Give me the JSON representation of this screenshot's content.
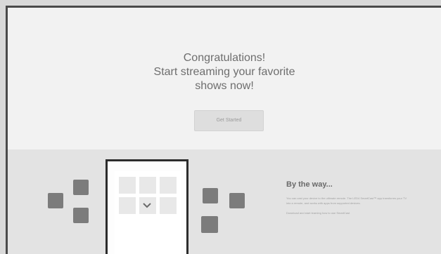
{
  "promo": {
    "headline_line1": "Congratulations!",
    "headline_line2": "Start streaming your favorite",
    "headline_line3": "shows now!",
    "cta_label": "Get Started"
  },
  "info": {
    "title": "By the way...",
    "paragraph1": "You can cast your device to the ultimate remote. The LED4 SmartCast™ app transforms your TV into a remote, and works with apps from supported devices.",
    "paragraph2": "Download and start learning how to use SmartCast"
  },
  "icons": {
    "chevron": "chevron-down-icon"
  }
}
